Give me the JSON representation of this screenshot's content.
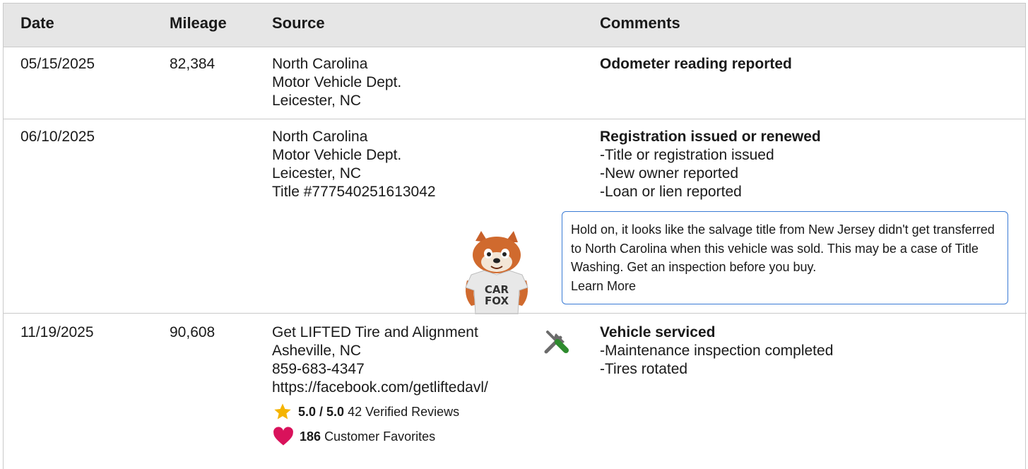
{
  "headers": {
    "date": "Date",
    "mileage": "Mileage",
    "source": "Source",
    "comments": "Comments"
  },
  "rows": [
    {
      "date": "05/15/2025",
      "mileage": "82,384",
      "source": [
        "North Carolina",
        "Motor Vehicle Dept.",
        "Leicester, NC"
      ],
      "comment_title": "Odometer reading reported",
      "bullets": []
    },
    {
      "date": "06/10/2025",
      "mileage": "",
      "source": [
        "North Carolina",
        "Motor Vehicle Dept.",
        "Leicester, NC",
        "Title #777540251613042"
      ],
      "comment_title": "Registration issued or renewed",
      "bullets": [
        "Title or registration issued",
        "New owner reported",
        "Loan or lien reported"
      ],
      "alert": {
        "text": "Hold on, it looks like the salvage title from New Jersey didn't get transferred to North Carolina when this vehicle was sold. This may be a case of Title Washing. Get an inspection before you buy.",
        "link": "Learn More"
      },
      "mascot_shirt": [
        "CAR",
        "FOX"
      ]
    },
    {
      "date": "11/19/2025",
      "mileage": "90,608",
      "source": [
        "Get LIFTED Tire and Alignment",
        "Asheville, NC",
        "859-683-4347",
        "https://facebook.com/getliftedavl/"
      ],
      "comment_title": "Vehicle serviced",
      "bullets": [
        "Maintenance inspection completed",
        "Tires rotated"
      ],
      "rating": {
        "score": "5.0 / 5.0",
        "reviews": "42 Verified Reviews"
      },
      "favorites": {
        "count": "186",
        "label": "Customer Favorites"
      }
    }
  ],
  "colors": {
    "header_bg": "#e6e6e6",
    "alert_border": "#3a7bd5",
    "star": "#f5b400",
    "heart": "#d9125b",
    "tools_green": "#2e8b2e"
  },
  "icons": {
    "service": "tools-icon",
    "rating": "star-icon",
    "favorites": "heart-icon",
    "mascot": "carfox-mascot"
  }
}
